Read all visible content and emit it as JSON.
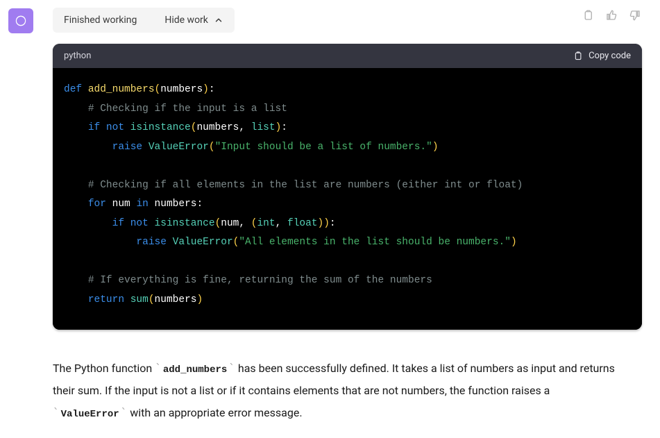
{
  "avatar": {
    "kind": "chatgpt-logo",
    "bg": "#a07cf0"
  },
  "status": {
    "label": "Finished working",
    "toggle_label": "Hide work"
  },
  "actions": {
    "clipboard": "clipboard-icon",
    "thumbs_up": "thumbs-up-icon",
    "thumbs_down": "thumbs-down-icon"
  },
  "code": {
    "language": "python",
    "copy_label": "Copy code",
    "tokens": [
      [
        [
          "kw",
          "def "
        ],
        [
          "fn",
          "add_numbers"
        ],
        [
          "paren",
          "("
        ],
        [
          "punc",
          "numbers"
        ],
        [
          "paren",
          ")"
        ],
        [
          "punc",
          ":"
        ]
      ],
      [
        [
          "punc",
          "    "
        ],
        [
          "cmt",
          "# Checking if the input is a list"
        ]
      ],
      [
        [
          "punc",
          "    "
        ],
        [
          "kw",
          "if"
        ],
        [
          "punc",
          " "
        ],
        [
          "kw",
          "not"
        ],
        [
          "punc",
          " "
        ],
        [
          "call",
          "isinstance"
        ],
        [
          "paren",
          "("
        ],
        [
          "punc",
          "numbers, "
        ],
        [
          "type",
          "list"
        ],
        [
          "paren",
          ")"
        ],
        [
          "punc",
          ":"
        ]
      ],
      [
        [
          "punc",
          "        "
        ],
        [
          "kw",
          "raise"
        ],
        [
          "punc",
          " "
        ],
        [
          "call",
          "ValueError"
        ],
        [
          "paren",
          "("
        ],
        [
          "str",
          "\"Input should be a list of numbers.\""
        ],
        [
          "paren",
          ")"
        ]
      ],
      [],
      [
        [
          "punc",
          "    "
        ],
        [
          "cmt",
          "# Checking if all elements in the list are numbers (either int or float)"
        ]
      ],
      [
        [
          "punc",
          "    "
        ],
        [
          "kw",
          "for"
        ],
        [
          "punc",
          " num "
        ],
        [
          "kw",
          "in"
        ],
        [
          "punc",
          " numbers:"
        ]
      ],
      [
        [
          "punc",
          "        "
        ],
        [
          "kw",
          "if"
        ],
        [
          "punc",
          " "
        ],
        [
          "kw",
          "not"
        ],
        [
          "punc",
          " "
        ],
        [
          "call",
          "isinstance"
        ],
        [
          "paren",
          "("
        ],
        [
          "punc",
          "num, "
        ],
        [
          "paren",
          "("
        ],
        [
          "type",
          "int"
        ],
        [
          "punc",
          ", "
        ],
        [
          "type",
          "float"
        ],
        [
          "paren",
          "))"
        ],
        [
          "punc",
          ":"
        ]
      ],
      [
        [
          "punc",
          "            "
        ],
        [
          "kw",
          "raise"
        ],
        [
          "punc",
          " "
        ],
        [
          "call",
          "ValueError"
        ],
        [
          "paren",
          "("
        ],
        [
          "str",
          "\"All elements in the list should be numbers.\""
        ],
        [
          "paren",
          ")"
        ]
      ],
      [],
      [
        [
          "punc",
          "    "
        ],
        [
          "cmt",
          "# If everything is fine, returning the sum of the numbers"
        ]
      ],
      [
        [
          "punc",
          "    "
        ],
        [
          "kw",
          "return"
        ],
        [
          "punc",
          " "
        ],
        [
          "call",
          "sum"
        ],
        [
          "paren",
          "("
        ],
        [
          "punc",
          "numbers"
        ],
        [
          "paren",
          ")"
        ]
      ]
    ]
  },
  "explanation": {
    "parts": [
      {
        "t": "text",
        "v": "The Python function "
      },
      {
        "t": "code",
        "v": "add_numbers"
      },
      {
        "t": "text",
        "v": " has been successfully defined. It takes a list of numbers as input and returns their sum. If the input is not a list or if it contains elements that are not numbers, the function raises a "
      },
      {
        "t": "code",
        "v": "ValueError"
      },
      {
        "t": "text",
        "v": " with an appropriate error message."
      }
    ]
  }
}
